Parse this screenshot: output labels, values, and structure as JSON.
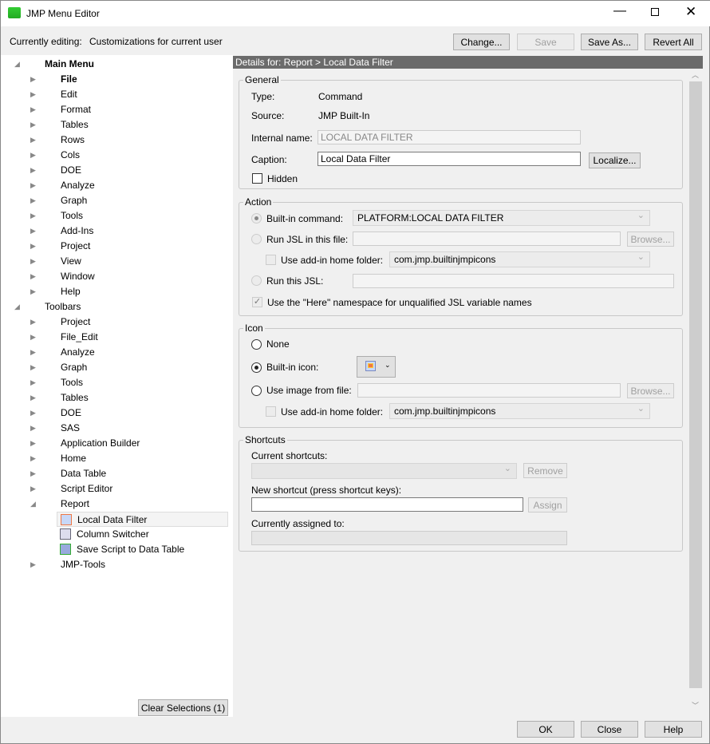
{
  "window": {
    "title": "JMP Menu Editor"
  },
  "top": {
    "editing_label": "Currently editing:",
    "editing_value": "Customizations for current user",
    "change": "Change...",
    "save": "Save",
    "save_as": "Save As...",
    "revert_all": "Revert All"
  },
  "tree": {
    "main_menu": "Main Menu",
    "menu_items": [
      "File",
      "Edit",
      "Format",
      "Tables",
      "Rows",
      "Cols",
      "DOE",
      "Analyze",
      "Graph",
      "Tools",
      "Add-Ins",
      "Project",
      "View",
      "Window",
      "Help"
    ],
    "toolbars": "Toolbars",
    "toolbar_items": [
      "Project",
      "File_Edit",
      "Analyze",
      "Graph",
      "Tools",
      "Tables",
      "DOE",
      "SAS",
      "Application Builder",
      "Home",
      "Data Table",
      "Script Editor",
      "Report"
    ],
    "report_children": [
      "Local Data Filter",
      "Column Switcher",
      "Save Script to Data Table"
    ],
    "last_item": "JMP-Tools",
    "clear_selections": "Clear Selections (1)"
  },
  "details": {
    "header": "Details for:  Report > Local Data Filter",
    "general": {
      "title": "General",
      "type_label": "Type:",
      "type_value": "Command",
      "source_label": "Source:",
      "source_value": "JMP Built-In",
      "internal_label": "Internal name:",
      "internal_value": "LOCAL DATA FILTER",
      "caption_label": "Caption:",
      "caption_value": "Local Data Filter",
      "localize": "Localize...",
      "hidden": "Hidden"
    },
    "action": {
      "title": "Action",
      "builtin_cmd": "Built-in command:",
      "builtin_value": "PLATFORM:LOCAL DATA FILTER",
      "run_file": "Run JSL in this file:",
      "browse": "Browse...",
      "use_addin": "Use add-in home folder:",
      "addin_value": "com.jmp.builtinjmpicons",
      "run_jsl": "Run this JSL:",
      "here_ns": "Use the \"Here\" namespace for unqualified JSL variable names"
    },
    "icon": {
      "title": "Icon",
      "none": "None",
      "builtin_icon": "Built-in icon:",
      "image_file": "Use image from file:",
      "browse": "Browse...",
      "use_addin": "Use add-in home folder:",
      "addin_value": "com.jmp.builtinjmpicons"
    },
    "shortcuts": {
      "title": "Shortcuts",
      "current": "Current shortcuts:",
      "remove": "Remove",
      "new": "New shortcut (press shortcut keys):",
      "assign": "Assign",
      "assigned": "Currently assigned to:"
    }
  },
  "footer": {
    "ok": "OK",
    "close": "Close",
    "help": "Help"
  }
}
